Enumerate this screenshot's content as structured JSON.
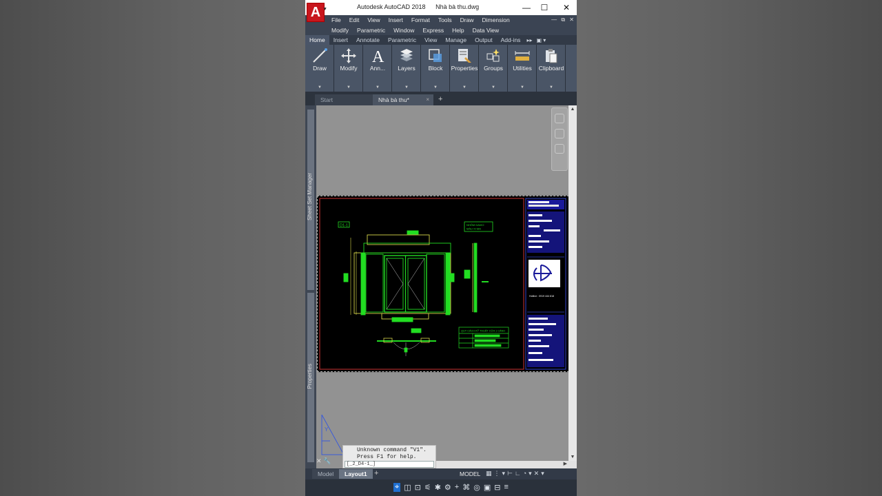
{
  "window": {
    "app_title": "Autodesk AutoCAD 2018",
    "file_title": "Nhà bà thu.dwg",
    "logo": "A",
    "minimize": "—",
    "maximize": "☐",
    "close": "✕",
    "doc_controls": "— ⧉ ✕"
  },
  "menus": {
    "row1": [
      "File",
      "Edit",
      "View",
      "Insert",
      "Format",
      "Tools",
      "Draw",
      "Dimension"
    ],
    "row2": [
      "Modify",
      "Parametric",
      "Window",
      "Express",
      "Help",
      "Data View"
    ]
  },
  "ribbon_tabs": [
    "Home",
    "Insert",
    "Annotate",
    "Parametric",
    "View",
    "Manage",
    "Output",
    "Add-ins"
  ],
  "ribbon_tabs_more": "▸▸",
  "ribbon_tabs_extra": "▣ ▾",
  "ribbon_panels": [
    {
      "label": "Draw",
      "icon": "line-icon"
    },
    {
      "label": "Modify",
      "icon": "move-icon"
    },
    {
      "label": "Ann...",
      "icon": "text-icon"
    },
    {
      "label": "Layers",
      "icon": "layers-icon"
    },
    {
      "label": "Block",
      "icon": "block-icon"
    },
    {
      "label": "Properties",
      "icon": "properties-icon"
    },
    {
      "label": "Groups",
      "icon": "groups-icon"
    },
    {
      "label": "Utilities",
      "icon": "measure-icon"
    },
    {
      "label": "Clipboard",
      "icon": "clipboard-icon"
    }
  ],
  "file_tabs": {
    "start": "Start",
    "doc": "Nhà bà thu*",
    "close": "×",
    "add": "+"
  },
  "palettes": {
    "sheet_set": "Sheet Set Manager",
    "properties": "Properties"
  },
  "drawing": {
    "tag": "D1-1",
    "note_box": [
      "NHÔM DAVIO",
      "MÀU XI MA"
    ],
    "schedule_title": "QUY CÁCH KỸ THUẬT CỬA 1 CÁNH",
    "titleblock_logo_caption": "Hotline : 0919 444 818"
  },
  "command_line": {
    "line1": "Unknown command \"V1\".",
    "line2": "Press F1 for help.",
    "input": "[_2_D4-1_]"
  },
  "layout_tabs": {
    "model": "Model",
    "layout": "Layout1",
    "add": "+"
  },
  "status": {
    "space": "MODEL"
  },
  "colors": {
    "accent": "#1f6fd0",
    "drawing_green": "#22dd22",
    "drawing_yellow": "#d8d84a",
    "titleblock_blue": "#1a1a9a"
  }
}
